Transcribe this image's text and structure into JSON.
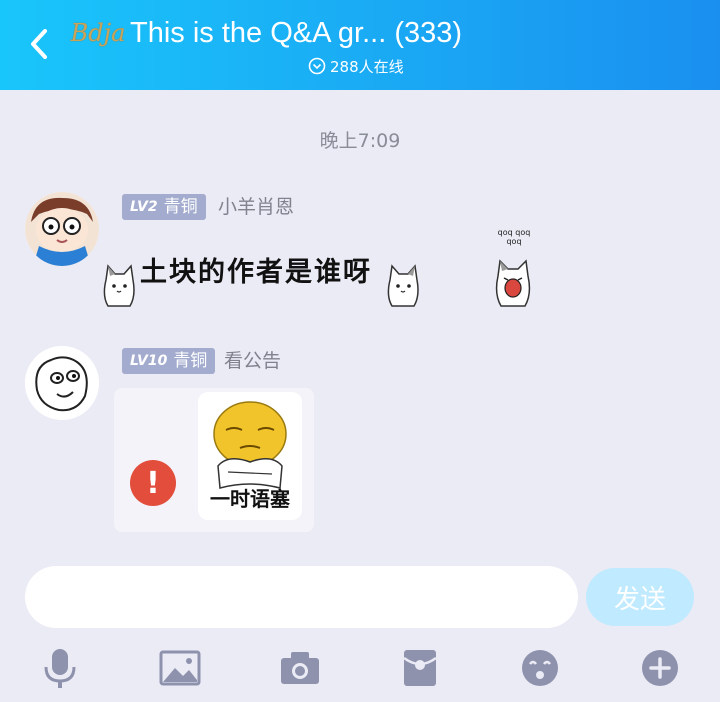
{
  "header": {
    "title": "This is the Q&A gr... (333)",
    "online": "288人在线",
    "logo_text": "Bdja"
  },
  "timestamp": "晚上7:09",
  "messages": [
    {
      "level": "LV2",
      "rank": "青铜",
      "nickname": "小羊肖恩",
      "text": "土块的作者是谁呀",
      "sticker_sound": "qoq qoq qoq"
    },
    {
      "level": "LV10",
      "rank": "青铜",
      "nickname": "看公告",
      "sticker_caption": "一时语塞",
      "status_icon": "!"
    }
  ],
  "input": {
    "value": "",
    "placeholder": ""
  },
  "send_label": "发送",
  "toolbar": [
    "mic-icon",
    "image-icon",
    "camera-icon",
    "red-packet-icon",
    "emoji-icon",
    "plus-icon"
  ],
  "colors": {
    "header_start": "#19c6fb",
    "header_end": "#1a8ff0",
    "send_button": "#bfeaff",
    "badge": "#a3acce",
    "error": "#e24d3c"
  }
}
